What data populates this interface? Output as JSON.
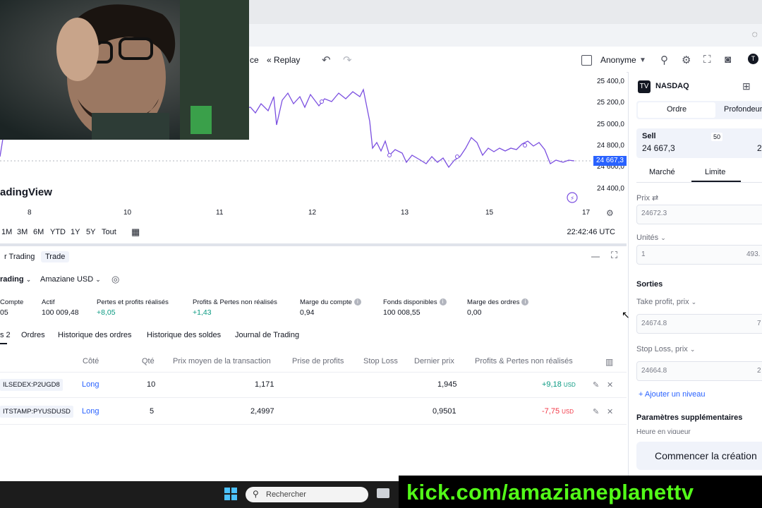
{
  "toolbar": {
    "partial_label": "ce",
    "replay": "Replay",
    "layout_name": "Anonyme"
  },
  "chart": {
    "symbol": "NASDAQ",
    "watermark": "adingView",
    "last_price": "24 667,3",
    "price_ticks": [
      "25 400,0",
      "25 200,0",
      "25 000,0",
      "24 800,0",
      "24 600,0",
      "24 400,0"
    ],
    "time_ticks": [
      "8",
      "10",
      "11",
      "12",
      "13",
      "15",
      "17"
    ],
    "ranges": [
      "1M",
      "3M",
      "6M",
      "YTD",
      "1Y",
      "5Y",
      "Tout"
    ],
    "clock": "22:42:46 UTC"
  },
  "panel": {
    "tabs": [
      "r Trading",
      "Trade"
    ],
    "account_mode": "rading",
    "account_name": "Amaziane USD",
    "metrics": [
      {
        "label": "Compte",
        "value": "05"
      },
      {
        "label": "Actif",
        "value": "100 009,48"
      },
      {
        "label": "Pertes et profits réalisés",
        "value": "+8,05"
      },
      {
        "label": "Profits & Pertes non réalisés",
        "value": "+1,43"
      },
      {
        "label": "Marge du compte",
        "value": "0,94"
      },
      {
        "label": "Fonds disponibles",
        "value": "100 008,55"
      },
      {
        "label": "Marge des ordres",
        "value": "0,00"
      }
    ],
    "subtabs": [
      "s 2",
      "Ordres",
      "Historique des ordres",
      "Historique des soldes",
      "Journal de Trading"
    ],
    "columns": [
      "Côté",
      "Qté",
      "Prix moyen de la transaction",
      "Prise de profits",
      "Stop Loss",
      "Dernier prix",
      "Profits & Pertes non réalisés"
    ],
    "rows": [
      {
        "symbol": "ILSEDEX:P2UGD8",
        "side": "Long",
        "qty": "10",
        "avg": "1,171",
        "last": "1,945",
        "pnl": "+9,18",
        "unit": "USD"
      },
      {
        "symbol": "ITSTAMP:PYUSDUSD",
        "side": "Long",
        "qty": "5",
        "avg": "2,4997",
        "last": "0,9501",
        "pnl": "-7,75",
        "unit": "USD"
      }
    ]
  },
  "order_panel": {
    "symbol": "NASDAQ",
    "tabs": [
      "Ordre",
      "Profondeur"
    ],
    "sell_label": "Sell",
    "sell_price": "24 667,3",
    "spread": "50",
    "buy_partial": "2",
    "type_tabs": [
      "Marché",
      "Limite"
    ],
    "price_label": "Prix",
    "price_value": "24672.3",
    "units_label": "Unités",
    "units_value": "1",
    "units_right": "493.",
    "exits_label": "Sorties",
    "tp_label": "Take profit, prix",
    "tp_value": "24674.8",
    "tp_right": "7",
    "sl_label": "Stop Loss, prix",
    "sl_value": "24664.8",
    "sl_right": "2",
    "add_level": "+ Ajouter un niveau",
    "extra_params": "Paramètres supplémentaires",
    "validity_partial": "Heure en vigueur",
    "cta": "Commencer la création"
  },
  "taskbar": {
    "search_placeholder": "Rechercher"
  },
  "overlay": {
    "kick_text": "kick.com/amazianeplanettv"
  },
  "colors": {
    "accent": "#2962ff",
    "positive": "#089981",
    "negative": "#f23645",
    "chart_line": "#7b4fe0",
    "kick_green": "#53fc18"
  }
}
